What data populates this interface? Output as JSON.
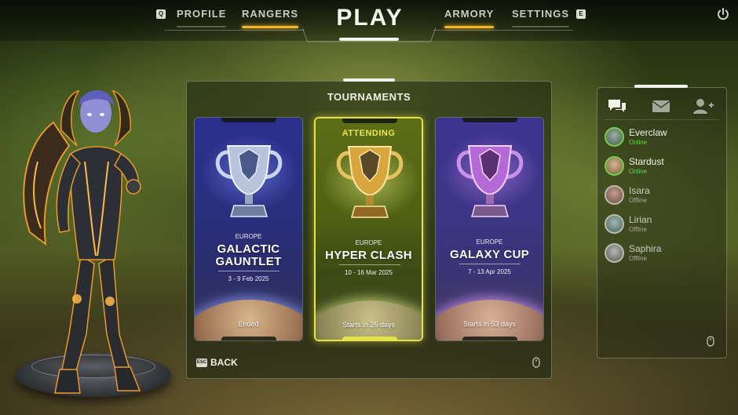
{
  "nav": {
    "left_key": "Q",
    "right_key": "E",
    "items": [
      {
        "label": "PROFILE"
      },
      {
        "label": "RANGERS"
      },
      {
        "label": "ARMORY"
      },
      {
        "label": "SETTINGS"
      }
    ],
    "title": "PLAY",
    "power_icon": "power-icon"
  },
  "panel": {
    "title": "TOURNAMENTS",
    "back_key": "ESC",
    "back_label": "BACK"
  },
  "tournaments": [
    {
      "region": "EUROPE",
      "name_line1": "GALACTIC",
      "name_line2": "GAUNTLET",
      "dates": "3 - 9 Feb 2025",
      "status": "Ended",
      "trophy": "silver-trophy-icon",
      "theme": "blue"
    },
    {
      "badge": "ATTENDING",
      "region": "EUROPE",
      "name_line1": "HYPER CLASH",
      "dates": "10 - 16 Mar 2025",
      "status": "Starts in 25 days",
      "trophy": "gold-trophy-icon",
      "theme": "green"
    },
    {
      "region": "EUROPE",
      "name_line1": "GALAXY CUP",
      "dates": "7 - 13 Apr 2025",
      "status": "Starts in 53 days",
      "trophy": "purple-trophy-icon",
      "theme": "purple"
    }
  ],
  "friends_panel": {
    "tabs": [
      {
        "icon": "chat-icon"
      },
      {
        "icon": "mail-icon"
      },
      {
        "icon": "add-friend-icon"
      }
    ],
    "friends": [
      {
        "name": "Everclaw",
        "status": "Online"
      },
      {
        "name": "Stardust",
        "status": "Online"
      },
      {
        "name": "Isara",
        "status": "Offline"
      },
      {
        "name": "Lirian",
        "status": "Offline"
      },
      {
        "name": "Saphira",
        "status": "Offline"
      }
    ]
  },
  "colors": {
    "accent": "#f2b530",
    "attending": "#e3e34a",
    "online": "#6fcf4a"
  }
}
